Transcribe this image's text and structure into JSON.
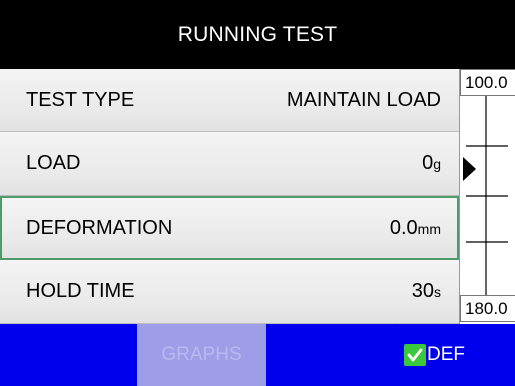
{
  "header": {
    "title": "RUNNING TEST"
  },
  "rows": [
    {
      "label": "TEST TYPE",
      "value": "MAINTAIN LOAD",
      "unit": ""
    },
    {
      "label": "LOAD",
      "value": "0",
      "unit": "g"
    },
    {
      "label": "DEFORMATION",
      "value": "0.0",
      "unit": "mm"
    },
    {
      "label": "HOLD TIME",
      "value": "30",
      "unit": "s"
    }
  ],
  "scale": {
    "top_label": "100.0",
    "bottom_label": "180.0"
  },
  "footer": {
    "graphs_label": "GRAPHS",
    "def_label": "DEF"
  },
  "colors": {
    "accent_blue": "#0000ee",
    "selected_border": "#4e9a6b",
    "check_green": "#3cc83c"
  },
  "icons": {
    "pointer": "triangle-right-icon",
    "check": "check-icon"
  }
}
